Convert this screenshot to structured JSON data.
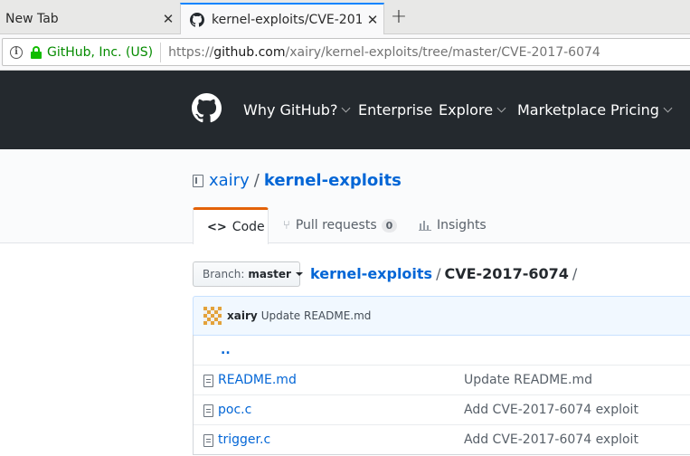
{
  "browser": {
    "tabs": [
      {
        "title": "New Tab",
        "active": false
      },
      {
        "title": "kernel-exploits/CVE-201",
        "active": true
      }
    ],
    "new_tab_label": "+",
    "close_glyph": "✕",
    "identity": "GitHub, Inc. (US)",
    "url_prefix": "https://",
    "url_host": "github.com",
    "url_path": "/xairy/kernel-exploits/tree/master/CVE-2017-6074",
    "icons": [
      "info-icon",
      "lock-icon",
      "github-favicon-icon"
    ],
    "accent_color": "#0a84ff",
    "secure_color": "#12bc00"
  },
  "github_header": {
    "nav": [
      {
        "label": "Why GitHub?",
        "dropdown": true
      },
      {
        "label": "Enterprise",
        "dropdown": false
      },
      {
        "label": "Explore",
        "dropdown": true
      },
      {
        "label": "Marketplace",
        "dropdown": false
      },
      {
        "label": "Pricing",
        "dropdown": true
      }
    ],
    "background": "#24292e"
  },
  "repo": {
    "owner": "xairy",
    "separator": "/",
    "name": "kernel-exploits",
    "tabs": [
      {
        "label": "Code",
        "icon": "code-icon",
        "selected": true
      },
      {
        "label": "Pull requests",
        "icon": "pull-request-icon",
        "count": "0"
      },
      {
        "label": "Insights",
        "icon": "graph-icon"
      }
    ]
  },
  "branch": {
    "label": "Branch:",
    "value": "master"
  },
  "breadcrumb": {
    "root": "kernel-exploits",
    "sep": "/",
    "current": "CVE-2017-6074",
    "trail": "/"
  },
  "commit": {
    "author": "xairy",
    "message": "Update README.md"
  },
  "files": {
    "up_tree": "..",
    "rows": [
      {
        "name": "README.md",
        "message": "Update README.md",
        "icon": "file-icon"
      },
      {
        "name": "poc.c",
        "message": "Add CVE-2017-6074 exploit",
        "icon": "file-icon"
      },
      {
        "name": "trigger.c",
        "message": "Add CVE-2017-6074 exploit",
        "icon": "file-icon"
      }
    ]
  }
}
